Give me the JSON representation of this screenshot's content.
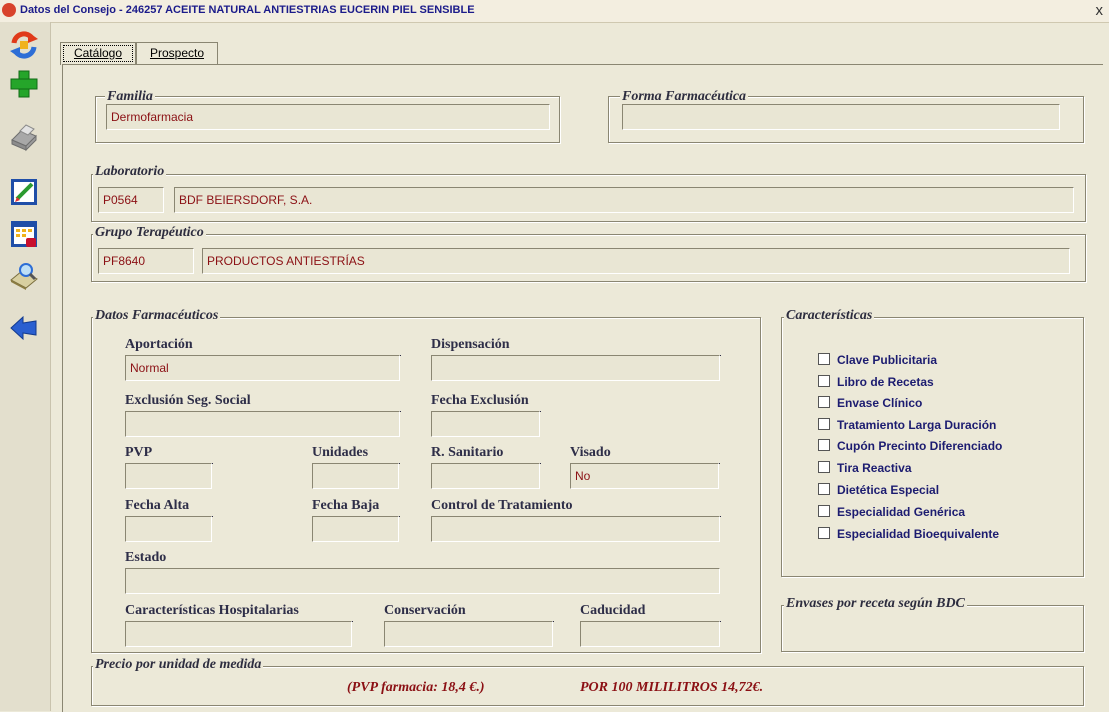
{
  "window": {
    "title": "Datos del Consejo - 246257 ACEITE NATURAL ANTIESTRIAS EUCERIN PIEL SENSIBLE",
    "close": "x"
  },
  "toolbar": {
    "buttons": [
      {
        "name": "refresh-icon"
      },
      {
        "name": "add-icon"
      },
      {
        "name": "print-icon"
      },
      {
        "name": "edit-document-icon"
      },
      {
        "name": "calendar-icon"
      },
      {
        "name": "search-book-icon"
      },
      {
        "name": "back-arrow-icon"
      }
    ]
  },
  "tabs": [
    {
      "label": "Catálogo"
    },
    {
      "label": "Prospecto"
    }
  ],
  "familia": {
    "legend": "Familia",
    "value": "Dermofarmacia"
  },
  "forma": {
    "legend": "Forma Farmacéutica",
    "value": ""
  },
  "laboratorio": {
    "legend": "Laboratorio",
    "code": "P0564",
    "name": "BDF BEIERSDORF, S.A."
  },
  "grupo": {
    "legend": "Grupo Terapéutico",
    "code": "PF8640",
    "name": "PRODUCTOS ANTIESTRÍAS"
  },
  "datos": {
    "legend": "Datos Farmacéuticos",
    "aportacion": {
      "label": "Aportación",
      "value": "Normal"
    },
    "dispensacion": {
      "label": "Dispensación",
      "value": ""
    },
    "exclusion": {
      "label": "Exclusión Seg. Social",
      "value": ""
    },
    "fecha_exclusion": {
      "label": "Fecha Exclusión",
      "value": ""
    },
    "pvp": {
      "label": "PVP",
      "value": ""
    },
    "unidades": {
      "label": "Unidades",
      "value": ""
    },
    "r_sanitario": {
      "label": "R. Sanitario",
      "value": ""
    },
    "visado": {
      "label": "Visado",
      "value": "No"
    },
    "fecha_alta": {
      "label": "Fecha Alta",
      "value": ""
    },
    "fecha_baja": {
      "label": "Fecha Baja",
      "value": ""
    },
    "control": {
      "label": "Control de Tratamiento",
      "value": ""
    },
    "estado": {
      "label": "Estado",
      "value": ""
    },
    "hospitalarias": {
      "label": "Características Hospitalarias",
      "value": ""
    },
    "conservacion": {
      "label": "Conservación",
      "value": ""
    },
    "caducidad": {
      "label": "Caducidad",
      "value": ""
    }
  },
  "caracteristicas": {
    "legend": "Características",
    "items": [
      "Clave Publicitaria",
      "Libro de Recetas",
      "Envase Clínico",
      "Tratamiento Larga Duración",
      "Cupón Precinto Diferenciado",
      "Tira Reactiva",
      "Dietética Especial",
      "Especialidad Genérica",
      "Especialidad Bioequivalente"
    ]
  },
  "envases": {
    "legend": "Envases por receta según BDC",
    "value": ""
  },
  "precio": {
    "legend": "Precio por unidad de medida",
    "pvp_farmacia": "(PVP farmacia: 18,4 €.)",
    "por_100": "POR 100 MILILITROS 14,72€."
  }
}
